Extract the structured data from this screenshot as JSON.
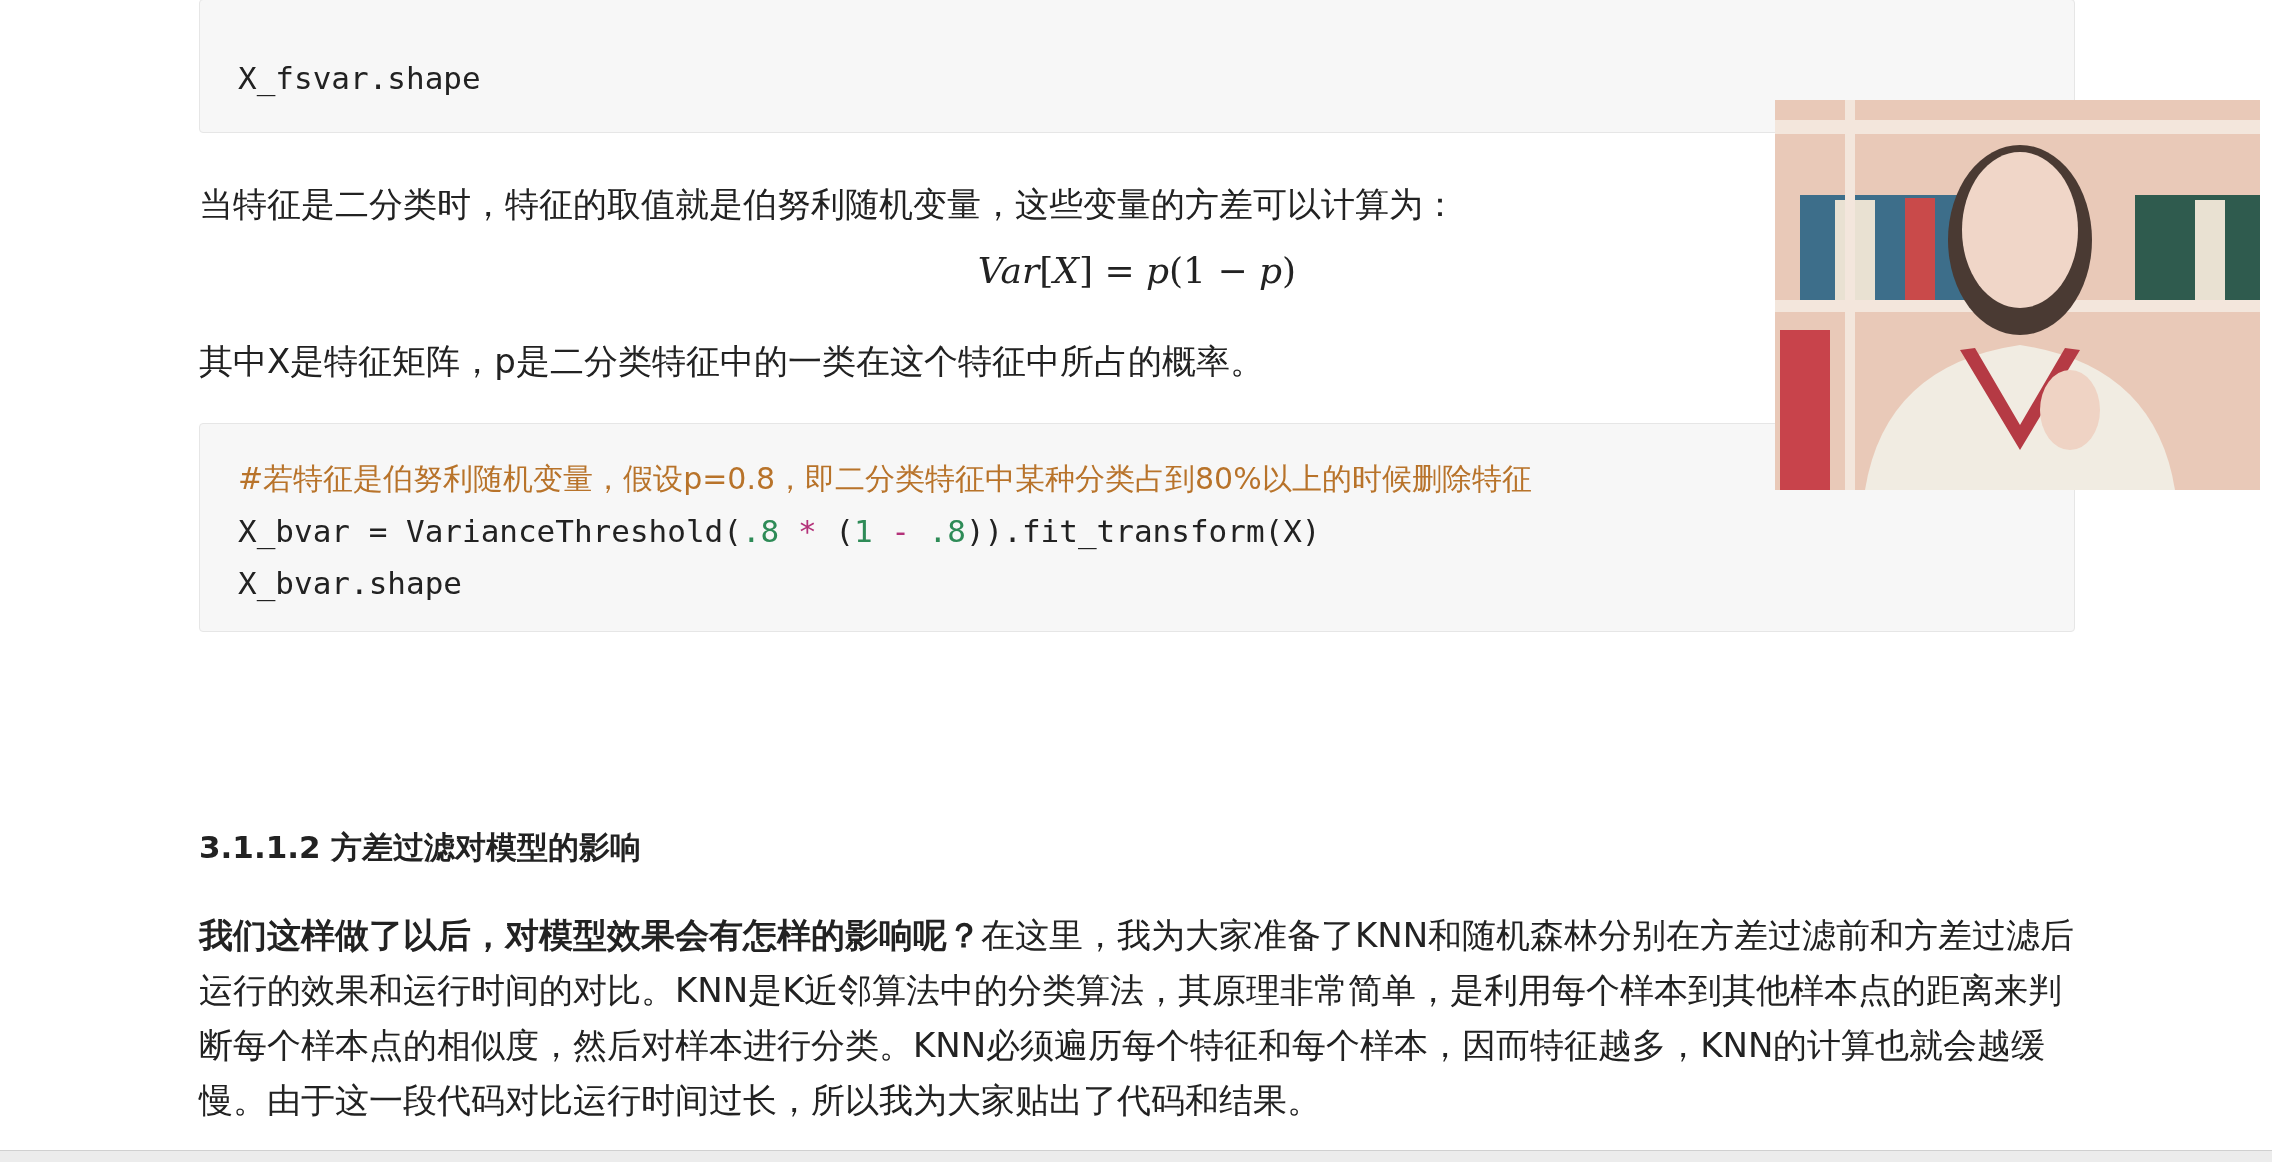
{
  "content": [
    {
      "kind": "code",
      "lines": [
        [
          {
            "kind": "plain",
            "text": "X_fsvar.shape"
          }
        ]
      ]
    },
    {
      "kind": "paragraph",
      "text": "当特征是二分类时，特征的取值就是伯努利随机变量，这些变量的方差可以计算为："
    },
    {
      "kind": "formula",
      "text": "*Var*[*X*] = *p*(1 − *p*)"
    },
    {
      "kind": "paragraph",
      "text": "其中X是特征矩阵，p是二分类特征中的一类在这个特征中所占的概率。"
    },
    {
      "kind": "code",
      "lines": [
        [
          {
            "kind": "comment",
            "text": "#若特征是伯努利随机变量，假设p=0.8，即二分类特征中某种分类占到80%以上的时候删除特征"
          }
        ],
        [
          {
            "kind": "plain",
            "text": "X_bvar = VarianceThreshold("
          },
          {
            "kind": "number",
            "text": ".8"
          },
          {
            "kind": "operator",
            "text": " * "
          },
          {
            "kind": "plain",
            "text": "("
          },
          {
            "kind": "number",
            "text": "1"
          },
          {
            "kind": "operator",
            "text": " - "
          },
          {
            "kind": "number",
            "text": ".8"
          },
          {
            "kind": "plain",
            "text": ")).fit_transform(X)"
          }
        ],
        [
          {
            "kind": "plain",
            "text": "X_bvar.shape"
          }
        ]
      ]
    },
    {
      "kind": "heading",
      "text": "3.1.1.2 方差过滤对模型的影响"
    },
    {
      "kind": "paragraph",
      "text": "**我们这样做了以后，对模型效果会有怎样的影响呢？**在这里，我为大家准备了KNN和随机森林分别在方差过滤前和方差过滤后运行的效果和运行时间的对比。KNN是K近邻算法中的分类算法，其原理非常简单，是利用每个样本到其他样本点的距离来判断每个样本点的相似度，然后对样本进行分类。KNN必须遍历每个特征和每个样本，因而特征越多，KNN的计算也就会越缓慢。由于这一段代码对比运行时间过长，所以我为大家贴出了代码和结果。"
    }
  ]
}
